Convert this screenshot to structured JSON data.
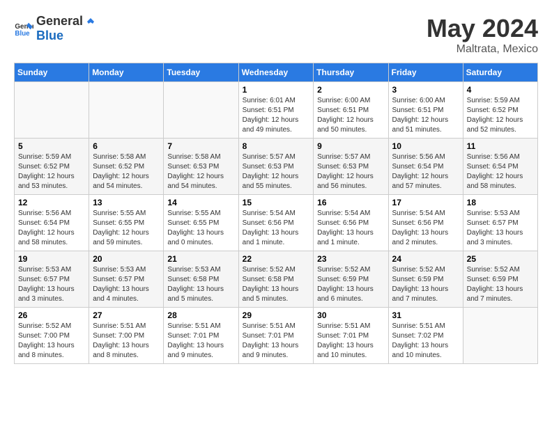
{
  "header": {
    "logo_general": "General",
    "logo_blue": "Blue",
    "title": "May 2024",
    "subtitle": "Maltrata, Mexico"
  },
  "days_of_week": [
    "Sunday",
    "Monday",
    "Tuesday",
    "Wednesday",
    "Thursday",
    "Friday",
    "Saturday"
  ],
  "weeks": [
    [
      {
        "day": "",
        "sunrise": "",
        "sunset": "",
        "daylight": ""
      },
      {
        "day": "",
        "sunrise": "",
        "sunset": "",
        "daylight": ""
      },
      {
        "day": "",
        "sunrise": "",
        "sunset": "",
        "daylight": ""
      },
      {
        "day": "1",
        "sunrise": "Sunrise: 6:01 AM",
        "sunset": "Sunset: 6:51 PM",
        "daylight": "Daylight: 12 hours and 49 minutes."
      },
      {
        "day": "2",
        "sunrise": "Sunrise: 6:00 AM",
        "sunset": "Sunset: 6:51 PM",
        "daylight": "Daylight: 12 hours and 50 minutes."
      },
      {
        "day": "3",
        "sunrise": "Sunrise: 6:00 AM",
        "sunset": "Sunset: 6:51 PM",
        "daylight": "Daylight: 12 hours and 51 minutes."
      },
      {
        "day": "4",
        "sunrise": "Sunrise: 5:59 AM",
        "sunset": "Sunset: 6:52 PM",
        "daylight": "Daylight: 12 hours and 52 minutes."
      }
    ],
    [
      {
        "day": "5",
        "sunrise": "Sunrise: 5:59 AM",
        "sunset": "Sunset: 6:52 PM",
        "daylight": "Daylight: 12 hours and 53 minutes."
      },
      {
        "day": "6",
        "sunrise": "Sunrise: 5:58 AM",
        "sunset": "Sunset: 6:52 PM",
        "daylight": "Daylight: 12 hours and 54 minutes."
      },
      {
        "day": "7",
        "sunrise": "Sunrise: 5:58 AM",
        "sunset": "Sunset: 6:53 PM",
        "daylight": "Daylight: 12 hours and 54 minutes."
      },
      {
        "day": "8",
        "sunrise": "Sunrise: 5:57 AM",
        "sunset": "Sunset: 6:53 PM",
        "daylight": "Daylight: 12 hours and 55 minutes."
      },
      {
        "day": "9",
        "sunrise": "Sunrise: 5:57 AM",
        "sunset": "Sunset: 6:53 PM",
        "daylight": "Daylight: 12 hours and 56 minutes."
      },
      {
        "day": "10",
        "sunrise": "Sunrise: 5:56 AM",
        "sunset": "Sunset: 6:54 PM",
        "daylight": "Daylight: 12 hours and 57 minutes."
      },
      {
        "day": "11",
        "sunrise": "Sunrise: 5:56 AM",
        "sunset": "Sunset: 6:54 PM",
        "daylight": "Daylight: 12 hours and 58 minutes."
      }
    ],
    [
      {
        "day": "12",
        "sunrise": "Sunrise: 5:56 AM",
        "sunset": "Sunset: 6:54 PM",
        "daylight": "Daylight: 12 hours and 58 minutes."
      },
      {
        "day": "13",
        "sunrise": "Sunrise: 5:55 AM",
        "sunset": "Sunset: 6:55 PM",
        "daylight": "Daylight: 12 hours and 59 minutes."
      },
      {
        "day": "14",
        "sunrise": "Sunrise: 5:55 AM",
        "sunset": "Sunset: 6:55 PM",
        "daylight": "Daylight: 13 hours and 0 minutes."
      },
      {
        "day": "15",
        "sunrise": "Sunrise: 5:54 AM",
        "sunset": "Sunset: 6:56 PM",
        "daylight": "Daylight: 13 hours and 1 minute."
      },
      {
        "day": "16",
        "sunrise": "Sunrise: 5:54 AM",
        "sunset": "Sunset: 6:56 PM",
        "daylight": "Daylight: 13 hours and 1 minute."
      },
      {
        "day": "17",
        "sunrise": "Sunrise: 5:54 AM",
        "sunset": "Sunset: 6:56 PM",
        "daylight": "Daylight: 13 hours and 2 minutes."
      },
      {
        "day": "18",
        "sunrise": "Sunrise: 5:53 AM",
        "sunset": "Sunset: 6:57 PM",
        "daylight": "Daylight: 13 hours and 3 minutes."
      }
    ],
    [
      {
        "day": "19",
        "sunrise": "Sunrise: 5:53 AM",
        "sunset": "Sunset: 6:57 PM",
        "daylight": "Daylight: 13 hours and 3 minutes."
      },
      {
        "day": "20",
        "sunrise": "Sunrise: 5:53 AM",
        "sunset": "Sunset: 6:57 PM",
        "daylight": "Daylight: 13 hours and 4 minutes."
      },
      {
        "day": "21",
        "sunrise": "Sunrise: 5:53 AM",
        "sunset": "Sunset: 6:58 PM",
        "daylight": "Daylight: 13 hours and 5 minutes."
      },
      {
        "day": "22",
        "sunrise": "Sunrise: 5:52 AM",
        "sunset": "Sunset: 6:58 PM",
        "daylight": "Daylight: 13 hours and 5 minutes."
      },
      {
        "day": "23",
        "sunrise": "Sunrise: 5:52 AM",
        "sunset": "Sunset: 6:59 PM",
        "daylight": "Daylight: 13 hours and 6 minutes."
      },
      {
        "day": "24",
        "sunrise": "Sunrise: 5:52 AM",
        "sunset": "Sunset: 6:59 PM",
        "daylight": "Daylight: 13 hours and 7 minutes."
      },
      {
        "day": "25",
        "sunrise": "Sunrise: 5:52 AM",
        "sunset": "Sunset: 6:59 PM",
        "daylight": "Daylight: 13 hours and 7 minutes."
      }
    ],
    [
      {
        "day": "26",
        "sunrise": "Sunrise: 5:52 AM",
        "sunset": "Sunset: 7:00 PM",
        "daylight": "Daylight: 13 hours and 8 minutes."
      },
      {
        "day": "27",
        "sunrise": "Sunrise: 5:51 AM",
        "sunset": "Sunset: 7:00 PM",
        "daylight": "Daylight: 13 hours and 8 minutes."
      },
      {
        "day": "28",
        "sunrise": "Sunrise: 5:51 AM",
        "sunset": "Sunset: 7:01 PM",
        "daylight": "Daylight: 13 hours and 9 minutes."
      },
      {
        "day": "29",
        "sunrise": "Sunrise: 5:51 AM",
        "sunset": "Sunset: 7:01 PM",
        "daylight": "Daylight: 13 hours and 9 minutes."
      },
      {
        "day": "30",
        "sunrise": "Sunrise: 5:51 AM",
        "sunset": "Sunset: 7:01 PM",
        "daylight": "Daylight: 13 hours and 10 minutes."
      },
      {
        "day": "31",
        "sunrise": "Sunrise: 5:51 AM",
        "sunset": "Sunset: 7:02 PM",
        "daylight": "Daylight: 13 hours and 10 minutes."
      },
      {
        "day": "",
        "sunrise": "",
        "sunset": "",
        "daylight": ""
      }
    ]
  ]
}
